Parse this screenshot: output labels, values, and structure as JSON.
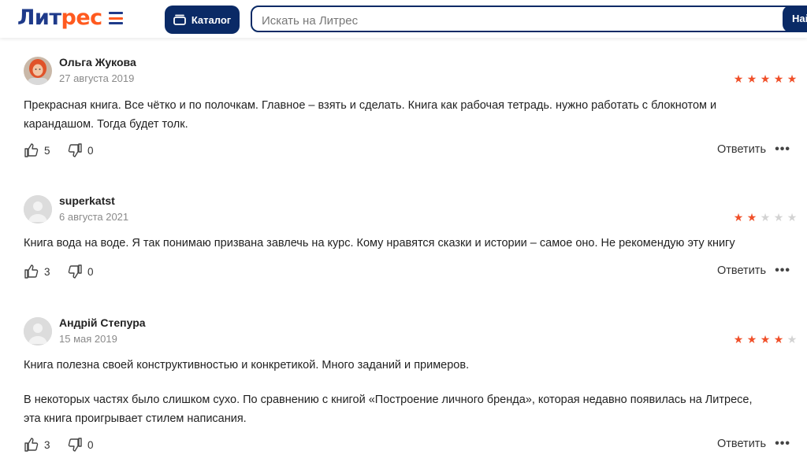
{
  "header": {
    "logo_part1": "Лит",
    "logo_part2": "рес",
    "catalog_label": "Каталог",
    "search_placeholder": "Искать на Литрес",
    "search_button": "Най",
    "colors": {
      "navy": "#0a2a66",
      "brand_orange": "#ff5a1f",
      "brand_blue": "#1e3a8a"
    }
  },
  "reviews": [
    {
      "author": "Ольга Жукова",
      "date": "27 августа 2019",
      "rating": 5,
      "text": [
        "Прекрасная книга. Все чётко и по полочкам. Главное – взять и сделать. Книга как рабочая тетрадь. нужно работать с блокнотом и",
        "карандашом. Тогда будет толк."
      ],
      "likes": "5",
      "dislikes": "0",
      "reply": "Ответить",
      "avatar": "photo"
    },
    {
      "author": "superkatst",
      "date": "6 августа 2021",
      "rating": 2,
      "text": [
        "Книга вода на воде. Я так понимаю призвана завлечь на курс. Кому нравятся сказки и истории – самое оно. Не рекомендую эту книгу"
      ],
      "likes": "3",
      "dislikes": "0",
      "reply": "Ответить",
      "avatar": "placeholder"
    },
    {
      "author": "Андрій Степура",
      "date": "15 мая 2019",
      "rating": 4,
      "text": [
        "Книга полезна своей конструктивностью и конкретикой. Много заданий и примеров.",
        "",
        "В некоторых частях было слишком сухо. По сравнению с книгой «Построение личного бренда», которая недавно появилась на Литресе,",
        "эта книга проигрывает стилем написания."
      ],
      "likes": "3",
      "dislikes": "0",
      "reply": "Ответить",
      "avatar": "placeholder"
    }
  ],
  "icons": {
    "like": "thumbs-up-icon",
    "dislike": "thumbs-down-icon",
    "more": "more-dots-icon",
    "star": "star-icon"
  },
  "star_colors": {
    "on": "#f0502a",
    "off": "#d3d3d3"
  }
}
